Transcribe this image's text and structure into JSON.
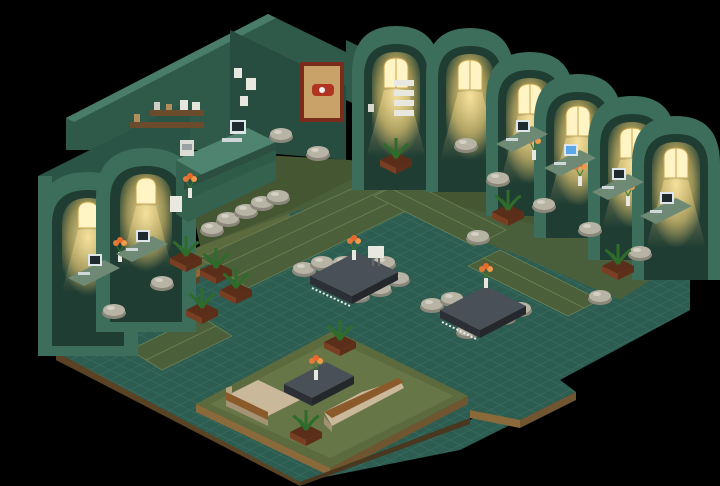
{
  "scene": {
    "kind": "isometric pixel-art room",
    "colors": {
      "background": "#000000",
      "wall": "#2f5a4a",
      "wall_dark": "#20453a",
      "wall_light": "#3d6e5c",
      "wall_top": "#4a7d69",
      "floor_tile": "#2d5c51",
      "floor_tile_line": "#3a6d61",
      "carpet": "#5c6b3e",
      "carpet_edge": "#4a5731",
      "platform_edge": "#8a6a3a",
      "window_light": "#f5d98a",
      "window_glow": "#e6c56a",
      "rock": "#b7b3a5",
      "rock_shadow": "#8b887b",
      "table": "#3c4148",
      "sofa": "#c9b99a",
      "plant": "#2f6b2a",
      "pot": "#7a3f22",
      "monitor": "#dfe6ea",
      "screen_blue": "#5aa9e6",
      "poster_frame": "#7a2b1a",
      "poster_bg": "#c9a26a"
    }
  }
}
